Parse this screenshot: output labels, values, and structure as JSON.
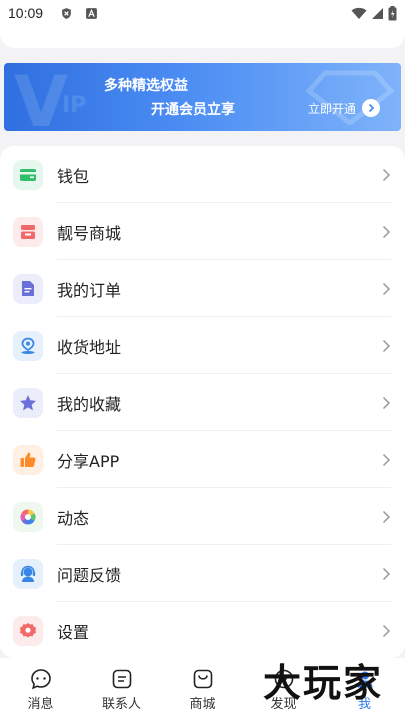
{
  "status_bar": {
    "time": "10:09"
  },
  "vip_banner": {
    "title": "多种精选权益",
    "subtitle": "开通会员立享",
    "action_label": "立即开通",
    "bg_letter": "V",
    "bg_letters_small": "IP"
  },
  "menu": {
    "items": [
      {
        "label": "钱包",
        "icon": "wallet-icon",
        "color": "#2fbf6a",
        "bg": "#e6f7ee"
      },
      {
        "label": "靓号商城",
        "icon": "store-icon",
        "color": "#f06a6a",
        "bg": "#fdeaea"
      },
      {
        "label": "我的订单",
        "icon": "order-icon",
        "color": "#6b6fd8",
        "bg": "#ecedfb"
      },
      {
        "label": "收货地址",
        "icon": "location-icon",
        "color": "#3a86e8",
        "bg": "#e6f0fc"
      },
      {
        "label": "我的收藏",
        "icon": "star-icon",
        "color": "#6b6fd8",
        "bg": "#ecedfb"
      },
      {
        "label": "分享APP",
        "icon": "thumbs-up-icon",
        "color": "#ff8a2a",
        "bg": "#fff0e3"
      },
      {
        "label": "动态",
        "icon": "moments-icon",
        "color": "#5cc46f",
        "bg": "#eef8ef"
      },
      {
        "label": "问题反馈",
        "icon": "feedback-icon",
        "color": "#3a86e8",
        "bg": "#e6f0fc"
      },
      {
        "label": "设置",
        "icon": "settings-icon",
        "color": "#f06a6a",
        "bg": "#fdeaea"
      }
    ]
  },
  "tabbar": {
    "tabs": [
      {
        "label": "消息",
        "icon": "message-icon"
      },
      {
        "label": "联系人",
        "icon": "contacts-icon"
      },
      {
        "label": "商城",
        "icon": "shop-bag-icon"
      },
      {
        "label": "发现",
        "icon": "discover-icon"
      },
      {
        "label": "我",
        "icon": "profile-icon",
        "active": true
      }
    ],
    "accent": "#2f7bf0"
  },
  "watermark": "大玩家"
}
